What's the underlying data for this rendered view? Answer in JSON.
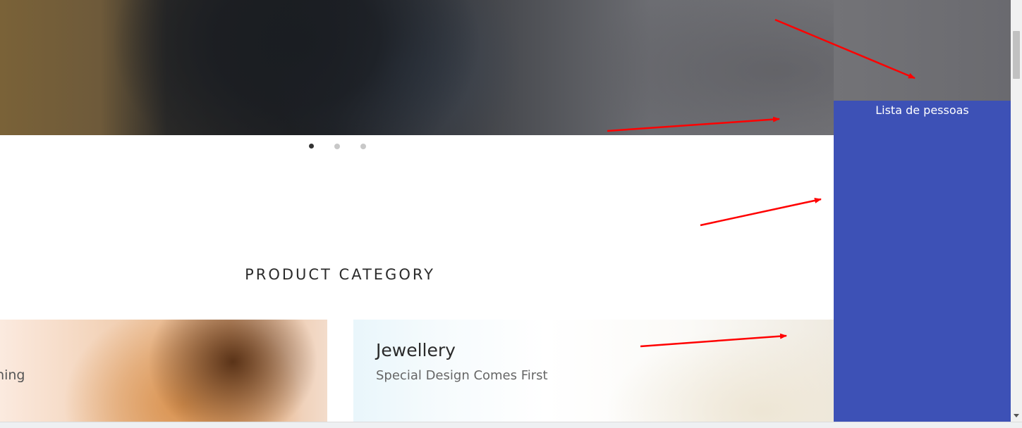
{
  "carousel": {
    "dots": [
      {
        "active": true
      },
      {
        "active": false
      },
      {
        "active": false
      }
    ]
  },
  "section": {
    "title": "PRODUCT CATEGORY"
  },
  "categories": [
    {
      "name": "othing",
      "subtitle": ""
    },
    {
      "name": "Jewellery",
      "subtitle": "Special Design Comes First"
    }
  ],
  "side_panel": {
    "title": "Lista de pessoas",
    "color": "#3d51b6"
  },
  "annotation": {
    "arrow_color": "#ff0000"
  }
}
